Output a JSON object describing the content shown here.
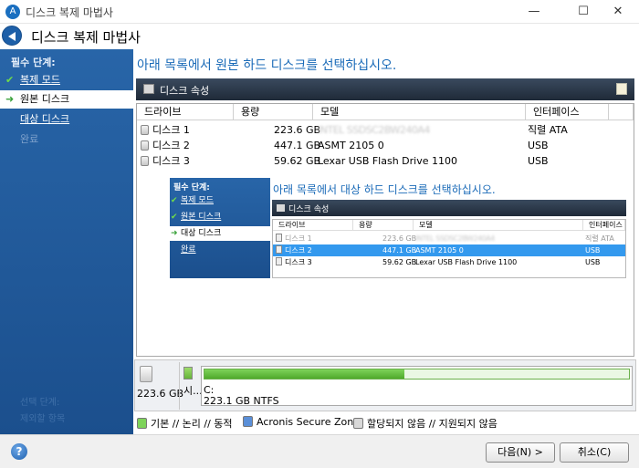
{
  "window": {
    "title": "디스크 복제 마법사",
    "minimize": "—",
    "maximize": "☐",
    "close": "✕"
  },
  "header": {
    "title": "디스크 복제 마법사"
  },
  "sidebar": {
    "heading": "필수 단계:",
    "items": [
      {
        "label": "복제 모드",
        "state": "done"
      },
      {
        "label": "원본 디스크",
        "state": "current"
      },
      {
        "label": "대상 디스크",
        "state": "link"
      },
      {
        "label": "완료",
        "state": "disabled"
      }
    ],
    "faint_items": [
      "선택 단계:",
      "제외할 항목"
    ]
  },
  "main": {
    "instruction": "아래 목록에서 원본 하드 디스크를 선택하십시오.",
    "properties_label": "디스크 속성",
    "columns": [
      "드라이브",
      "용량",
      "모델",
      "인터페이스"
    ],
    "rows": [
      {
        "drive": "디스크 1",
        "capacity": "223.6 GB",
        "model": "INTEL SSDSC2BW240A4",
        "interface": "직렬 ATA",
        "model_blurred": true
      },
      {
        "drive": "디스크 2",
        "capacity": "447.1 GB",
        "model": "ASMT 2105 0",
        "interface": "USB"
      },
      {
        "drive": "디스크 3",
        "capacity": "59.62 GB",
        "model": "Lexar USB Flash Drive 1100",
        "interface": "USB"
      }
    ]
  },
  "inset": {
    "heading": "필수 단계:",
    "items": [
      {
        "label": "복제 모드",
        "state": "done"
      },
      {
        "label": "원본 디스크",
        "state": "done"
      },
      {
        "label": "대상 디스크",
        "state": "current"
      },
      {
        "label": "완료",
        "state": "link"
      }
    ],
    "instruction": "아래 목록에서 대상 하드 디스크를 선택하십시오.",
    "properties_label": "디스크 속성",
    "columns": [
      "드라이브",
      "용량",
      "모델",
      "인터페이스"
    ],
    "rows": [
      {
        "drive": "디스크 1",
        "capacity": "223.6 GB",
        "model": "INTEL SSDSC2BW240A4",
        "interface": "직렬 ATA",
        "disabled": true
      },
      {
        "drive": "디스크 2",
        "capacity": "447.1 GB",
        "model": "ASMT 2105 0",
        "interface": "USB",
        "selected": true
      },
      {
        "drive": "디스크 3",
        "capacity": "59.62 GB",
        "model": "Lexar USB Flash Drive 1100",
        "interface": "USB"
      }
    ]
  },
  "disk_layout": {
    "disk_size": "223.6 GB",
    "partition_short": "시...",
    "partition_name": "C:",
    "partition_info": "223.1 GB  NTFS",
    "used_fraction": 0.47
  },
  "legend": [
    {
      "label": "기본 // 논리 // 동적",
      "color": "#7ed35a"
    },
    {
      "label": "Acronis Secure Zone",
      "color": "#5a8fd8"
    },
    {
      "label": "할당되지 않음 // 지원되지 않음",
      "color": "#d8d8d8"
    }
  ],
  "footer": {
    "help": "?",
    "next": "다음(N) >",
    "cancel": "취소(C)"
  }
}
